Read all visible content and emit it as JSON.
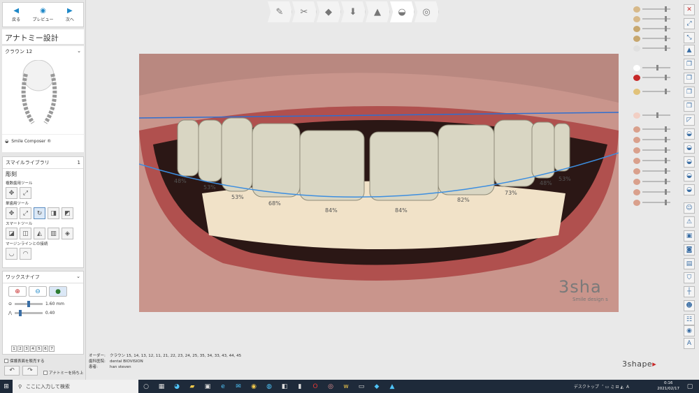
{
  "nav": {
    "back": "戻る",
    "preview": "プレビュー",
    "next": "次へ"
  },
  "panel_title": "アナトミー設計",
  "crown_label": "クラウン 12",
  "smile_composer": "Smile Composer ®",
  "library": {
    "header": "スマイルライブラリ",
    "page": "1",
    "section": "彫刻",
    "group1": "複数歯用ツール",
    "group2": "単歯用ツール",
    "group3": "スマートツール",
    "group4": "マージンラインとの接続"
  },
  "wax": {
    "header": "ワックスナイフ",
    "size_value": "1.60 mm",
    "strength_value": "0.40",
    "presets": [
      "1",
      "2",
      "3",
      "4",
      "5",
      "6",
      "7"
    ]
  },
  "checks": {
    "preserve": "保護表面を販売する",
    "keep_anatomy": "アナトミーを持ち上"
  },
  "percentages": [
    "48%",
    "53%",
    "68%",
    "84%",
    "84%",
    "82%",
    "73%",
    "48%",
    "53%"
  ],
  "watermark": "3sha",
  "watermark_sub": "Smile design s",
  "order": {
    "order_k": "オーダー:",
    "order_v": "クラウン 15, 14, 13, 12, 11, 21, 22, 23, 24, 25, 35, 34, 33, 43, 44, 45",
    "clinic_k": "歯科医院:",
    "clinic_v": "dental BIOVISION",
    "patient_k": "患者:",
    "patient_v": "han steven"
  },
  "logo": "3shape",
  "taskbar": {
    "search_placeholder": "ここに入力して検索",
    "desktop": "デスクトップ",
    "ime": "A",
    "time": "0:16",
    "date": "2021/02/17"
  },
  "colors": {
    "accent": "#1e88c8",
    "taskbar": "#1e2a3a",
    "smileline": "#2f6fd0"
  }
}
